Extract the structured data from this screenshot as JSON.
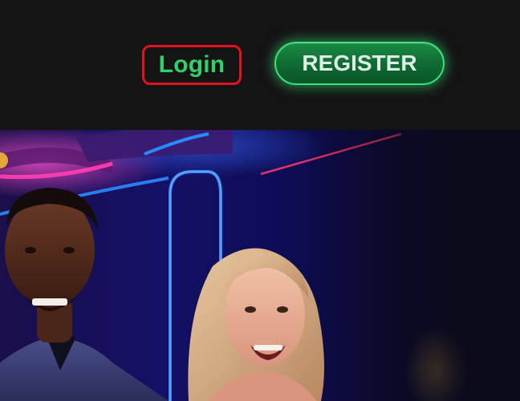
{
  "header": {
    "login_label": "Login",
    "register_label": "REGISTER"
  },
  "colors": {
    "page_background": "#141314",
    "login_text": "#2fd16a",
    "login_border": "#e0141e",
    "register_fill": "#0e6a32",
    "register_glow": "#3de07a",
    "register_text": "#dfeee4",
    "neon_blue": "#2a8bff",
    "neon_pink": "#ff3db1"
  },
  "hero": {
    "image": "casino-neon-smiling-couple"
  }
}
